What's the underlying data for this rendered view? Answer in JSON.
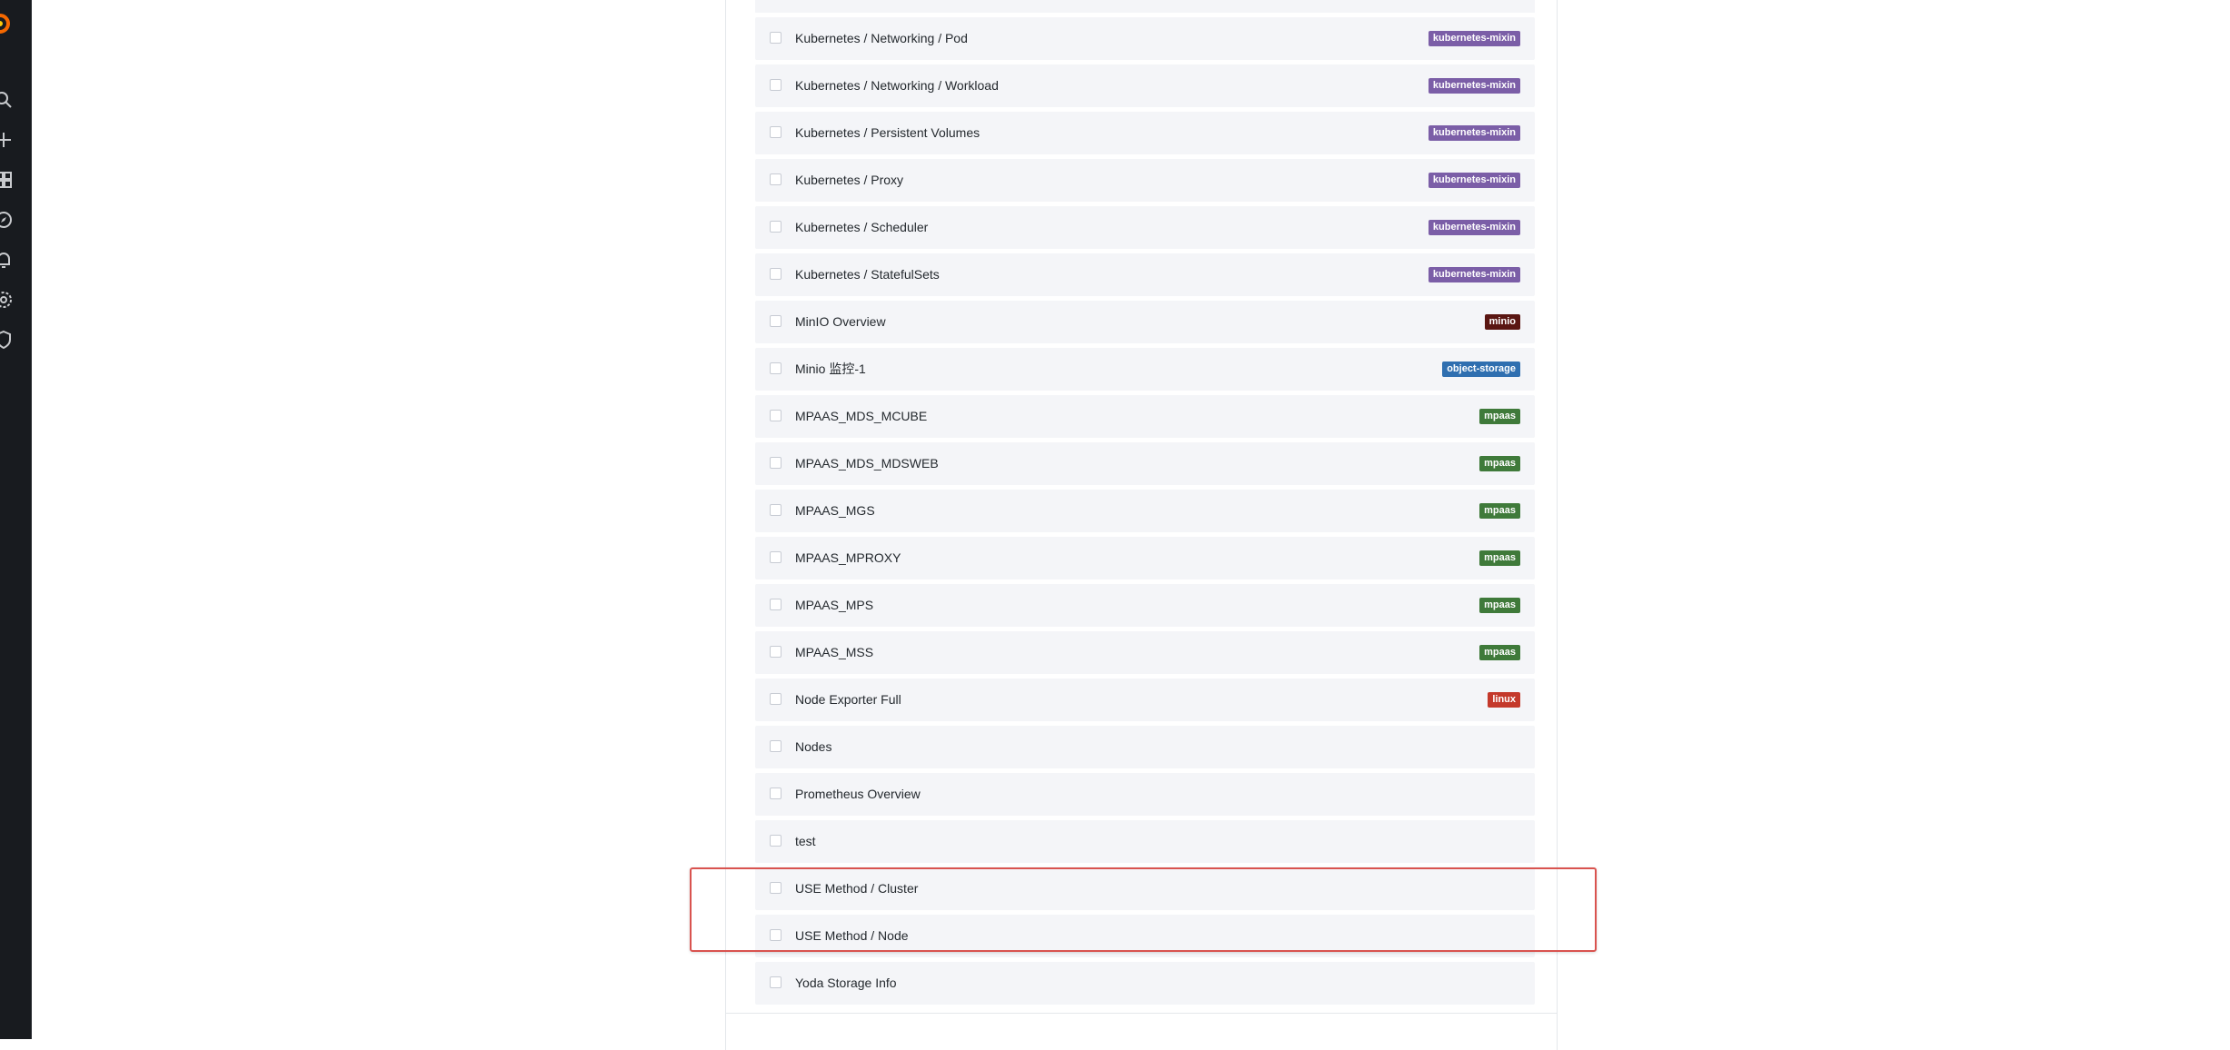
{
  "dashboards": [
    {
      "title": "Kubernetes / Networking / Pod",
      "tag": "kubernetes-mixin",
      "tag_color": "#7b5ea7"
    },
    {
      "title": "Kubernetes / Networking / Workload",
      "tag": "kubernetes-mixin",
      "tag_color": "#7b5ea7"
    },
    {
      "title": "Kubernetes / Persistent Volumes",
      "tag": "kubernetes-mixin",
      "tag_color": "#7b5ea7"
    },
    {
      "title": "Kubernetes / Proxy",
      "tag": "kubernetes-mixin",
      "tag_color": "#7b5ea7"
    },
    {
      "title": "Kubernetes / Scheduler",
      "tag": "kubernetes-mixin",
      "tag_color": "#7b5ea7"
    },
    {
      "title": "Kubernetes / StatefulSets",
      "tag": "kubernetes-mixin",
      "tag_color": "#7b5ea7"
    },
    {
      "title": "MinIO Overview",
      "tag": "minio",
      "tag_color": "#5a1612"
    },
    {
      "title": "Minio 监控-1",
      "tag": "object-storage",
      "tag_color": "#2f6fb0"
    },
    {
      "title": "MPAAS_MDS_MCUBE",
      "tag": "mpaas",
      "tag_color": "#3f7a3a"
    },
    {
      "title": "MPAAS_MDS_MDSWEB",
      "tag": "mpaas",
      "tag_color": "#3f7a3a"
    },
    {
      "title": "MPAAS_MGS",
      "tag": "mpaas",
      "tag_color": "#3f7a3a"
    },
    {
      "title": "MPAAS_MPROXY",
      "tag": "mpaas",
      "tag_color": "#3f7a3a"
    },
    {
      "title": "MPAAS_MPS",
      "tag": "mpaas",
      "tag_color": "#3f7a3a"
    },
    {
      "title": "MPAAS_MSS",
      "tag": "mpaas",
      "tag_color": "#3f7a3a"
    },
    {
      "title": "Node Exporter Full",
      "tag": "linux",
      "tag_color": "#c4392b"
    },
    {
      "title": "Nodes",
      "tag": "",
      "tag_color": ""
    },
    {
      "title": "Prometheus Overview",
      "tag": "",
      "tag_color": ""
    },
    {
      "title": "test",
      "tag": "",
      "tag_color": ""
    },
    {
      "title": "USE Method / Cluster",
      "tag": "",
      "tag_color": ""
    },
    {
      "title": "USE Method / Node",
      "tag": "",
      "tag_color": ""
    },
    {
      "title": "Yoda Storage Info",
      "tag": "",
      "tag_color": ""
    }
  ],
  "highlight_color": "#d9534f",
  "sidebar_icons": [
    "search-icon",
    "plus-icon",
    "dashboards-icon",
    "explore-icon",
    "alerting-icon",
    "gear-icon",
    "shield-icon"
  ]
}
